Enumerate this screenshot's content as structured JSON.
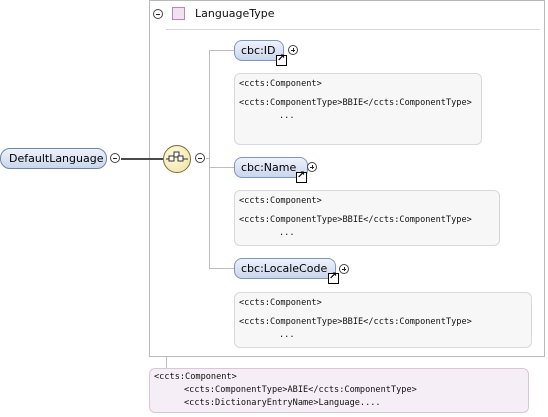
{
  "type_box": {
    "title": "LanguageType"
  },
  "root": {
    "label": "DefaultLanguage"
  },
  "elements": [
    {
      "label": "cbc:ID",
      "annotation": {
        "component": "<ccts:Component>",
        "component_type": "<ccts:ComponentType>BBIE</ccts:ComponentType>",
        "ellipsis": "..."
      }
    },
    {
      "label": "cbc:Name",
      "annotation": {
        "component": "<ccts:Component>",
        "component_type": "<ccts:ComponentType>BBIE</ccts:ComponentType>",
        "ellipsis": "..."
      }
    },
    {
      "label": "cbc:LocaleCode",
      "annotation": {
        "component": "<ccts:Component>",
        "component_type": "<ccts:ComponentType>BBIE</ccts:ComponentType>",
        "ellipsis": "..."
      }
    }
  ],
  "bottom_annotation": {
    "line1": "<ccts:Component>",
    "line2": "<ccts:ComponentType>ABIE</ccts:ComponentType>",
    "line3": "<ccts:DictionaryEntryName>Language...."
  },
  "colors": {
    "pill_border": "#7f97bc",
    "pill_fill": "#c9d6ec",
    "type_icon": "#f3e0f3",
    "sequence_fill": "#efe0a0"
  },
  "icons": [
    "collapse-icon",
    "expand-icon",
    "reference-arrow-icon",
    "sequence-icon",
    "complex-type-icon"
  ]
}
